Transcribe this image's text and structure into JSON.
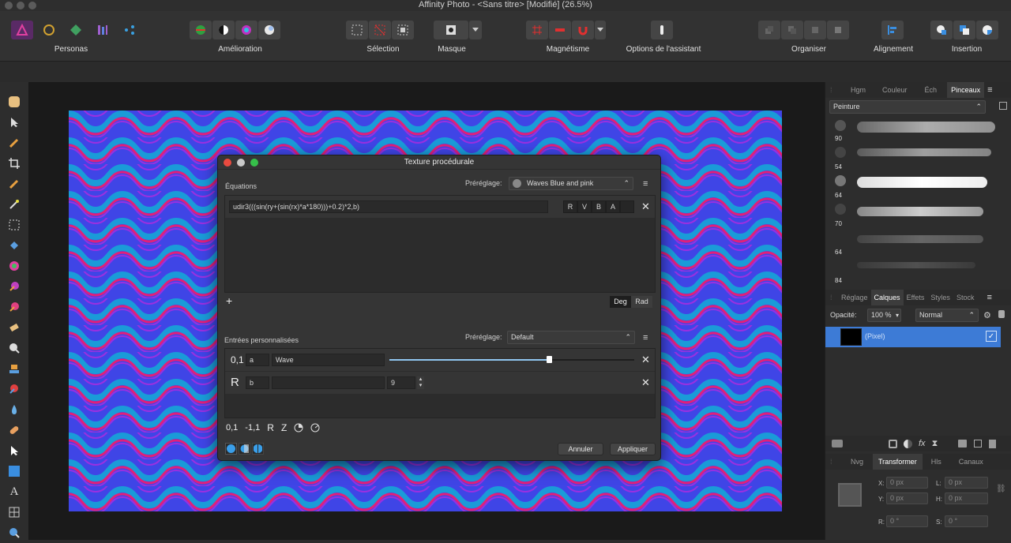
{
  "window": {
    "title": "Affinity Photo - <Sans titre> [Modifié] (26.5%)"
  },
  "toolbar": {
    "groups": [
      {
        "label": "Personas"
      },
      {
        "label": "Amélioration"
      },
      {
        "label": "Sélection"
      },
      {
        "label": "Masque"
      },
      {
        "label": "Magnétisme"
      },
      {
        "label": "Options de l'assistant"
      },
      {
        "label": "Organiser"
      },
      {
        "label": "Alignement"
      },
      {
        "label": "Insertion"
      }
    ]
  },
  "dialog": {
    "title": "Texture procédurale",
    "equations_label": "Équations",
    "preset_label": "Préréglage:",
    "preset_value": "Waves Blue and pink",
    "equation": "udir3(((sin(ry+(sin(rx)*a*180)))+0.2)*2,b)",
    "channels": [
      "R",
      "V",
      "B",
      "A"
    ],
    "add_label": "+",
    "deg_label": "Deg",
    "rad_label": "Rad",
    "custom_inputs_label": "Entrées personnalisées",
    "custom_preset_label": "Préréglage:",
    "custom_preset_value": "Default",
    "inputs": [
      {
        "type_label": "0,1",
        "var": "a",
        "name": "Wave",
        "slider": 0.65
      },
      {
        "type_label": "R",
        "var": "b",
        "name": "",
        "value": "9"
      }
    ],
    "add_input_types": [
      "0,1",
      "-1,1",
      "R",
      "Z"
    ],
    "cancel_label": "Annuler",
    "apply_label": "Appliquer"
  },
  "brushes_panel": {
    "tabs": [
      "Hgm",
      "Couleur",
      "Éch",
      "Pinceaux"
    ],
    "active_tab": "Pinceaux",
    "category": "Peinture",
    "brushes": [
      {
        "size": "90"
      },
      {
        "size": "54"
      },
      {
        "size": "64"
      },
      {
        "size": "70"
      },
      {
        "size": "64"
      },
      {
        "size": "84"
      }
    ]
  },
  "layers_panel": {
    "tabs": [
      "Réglage",
      "Calques",
      "Effets",
      "Styles",
      "Stock"
    ],
    "active_tab": "Calques",
    "opacity_label": "Opacité:",
    "opacity_value": "100 %",
    "blend_mode": "Normal",
    "layers": [
      {
        "name": "(Pixel)",
        "visible": "✓"
      }
    ]
  },
  "transform_panel": {
    "tabs": [
      "Nvg",
      "Transformer",
      "Hls",
      "Canaux"
    ],
    "active_tab": "Transformer",
    "fields": [
      {
        "label": "X:",
        "value": "0 px"
      },
      {
        "label": "L:",
        "value": "0 px"
      },
      {
        "label": "Y:",
        "value": "0 px"
      },
      {
        "label": "H:",
        "value": "0 px"
      },
      {
        "label": "R:",
        "value": "0 °"
      },
      {
        "label": "S:",
        "value": "0 °"
      }
    ]
  },
  "colors": {
    "accent": "#3d7bd6",
    "wave_blue": "#3a4fe0",
    "wave_pink": "#e0207a",
    "wave_cyan": "#18b8d0"
  }
}
